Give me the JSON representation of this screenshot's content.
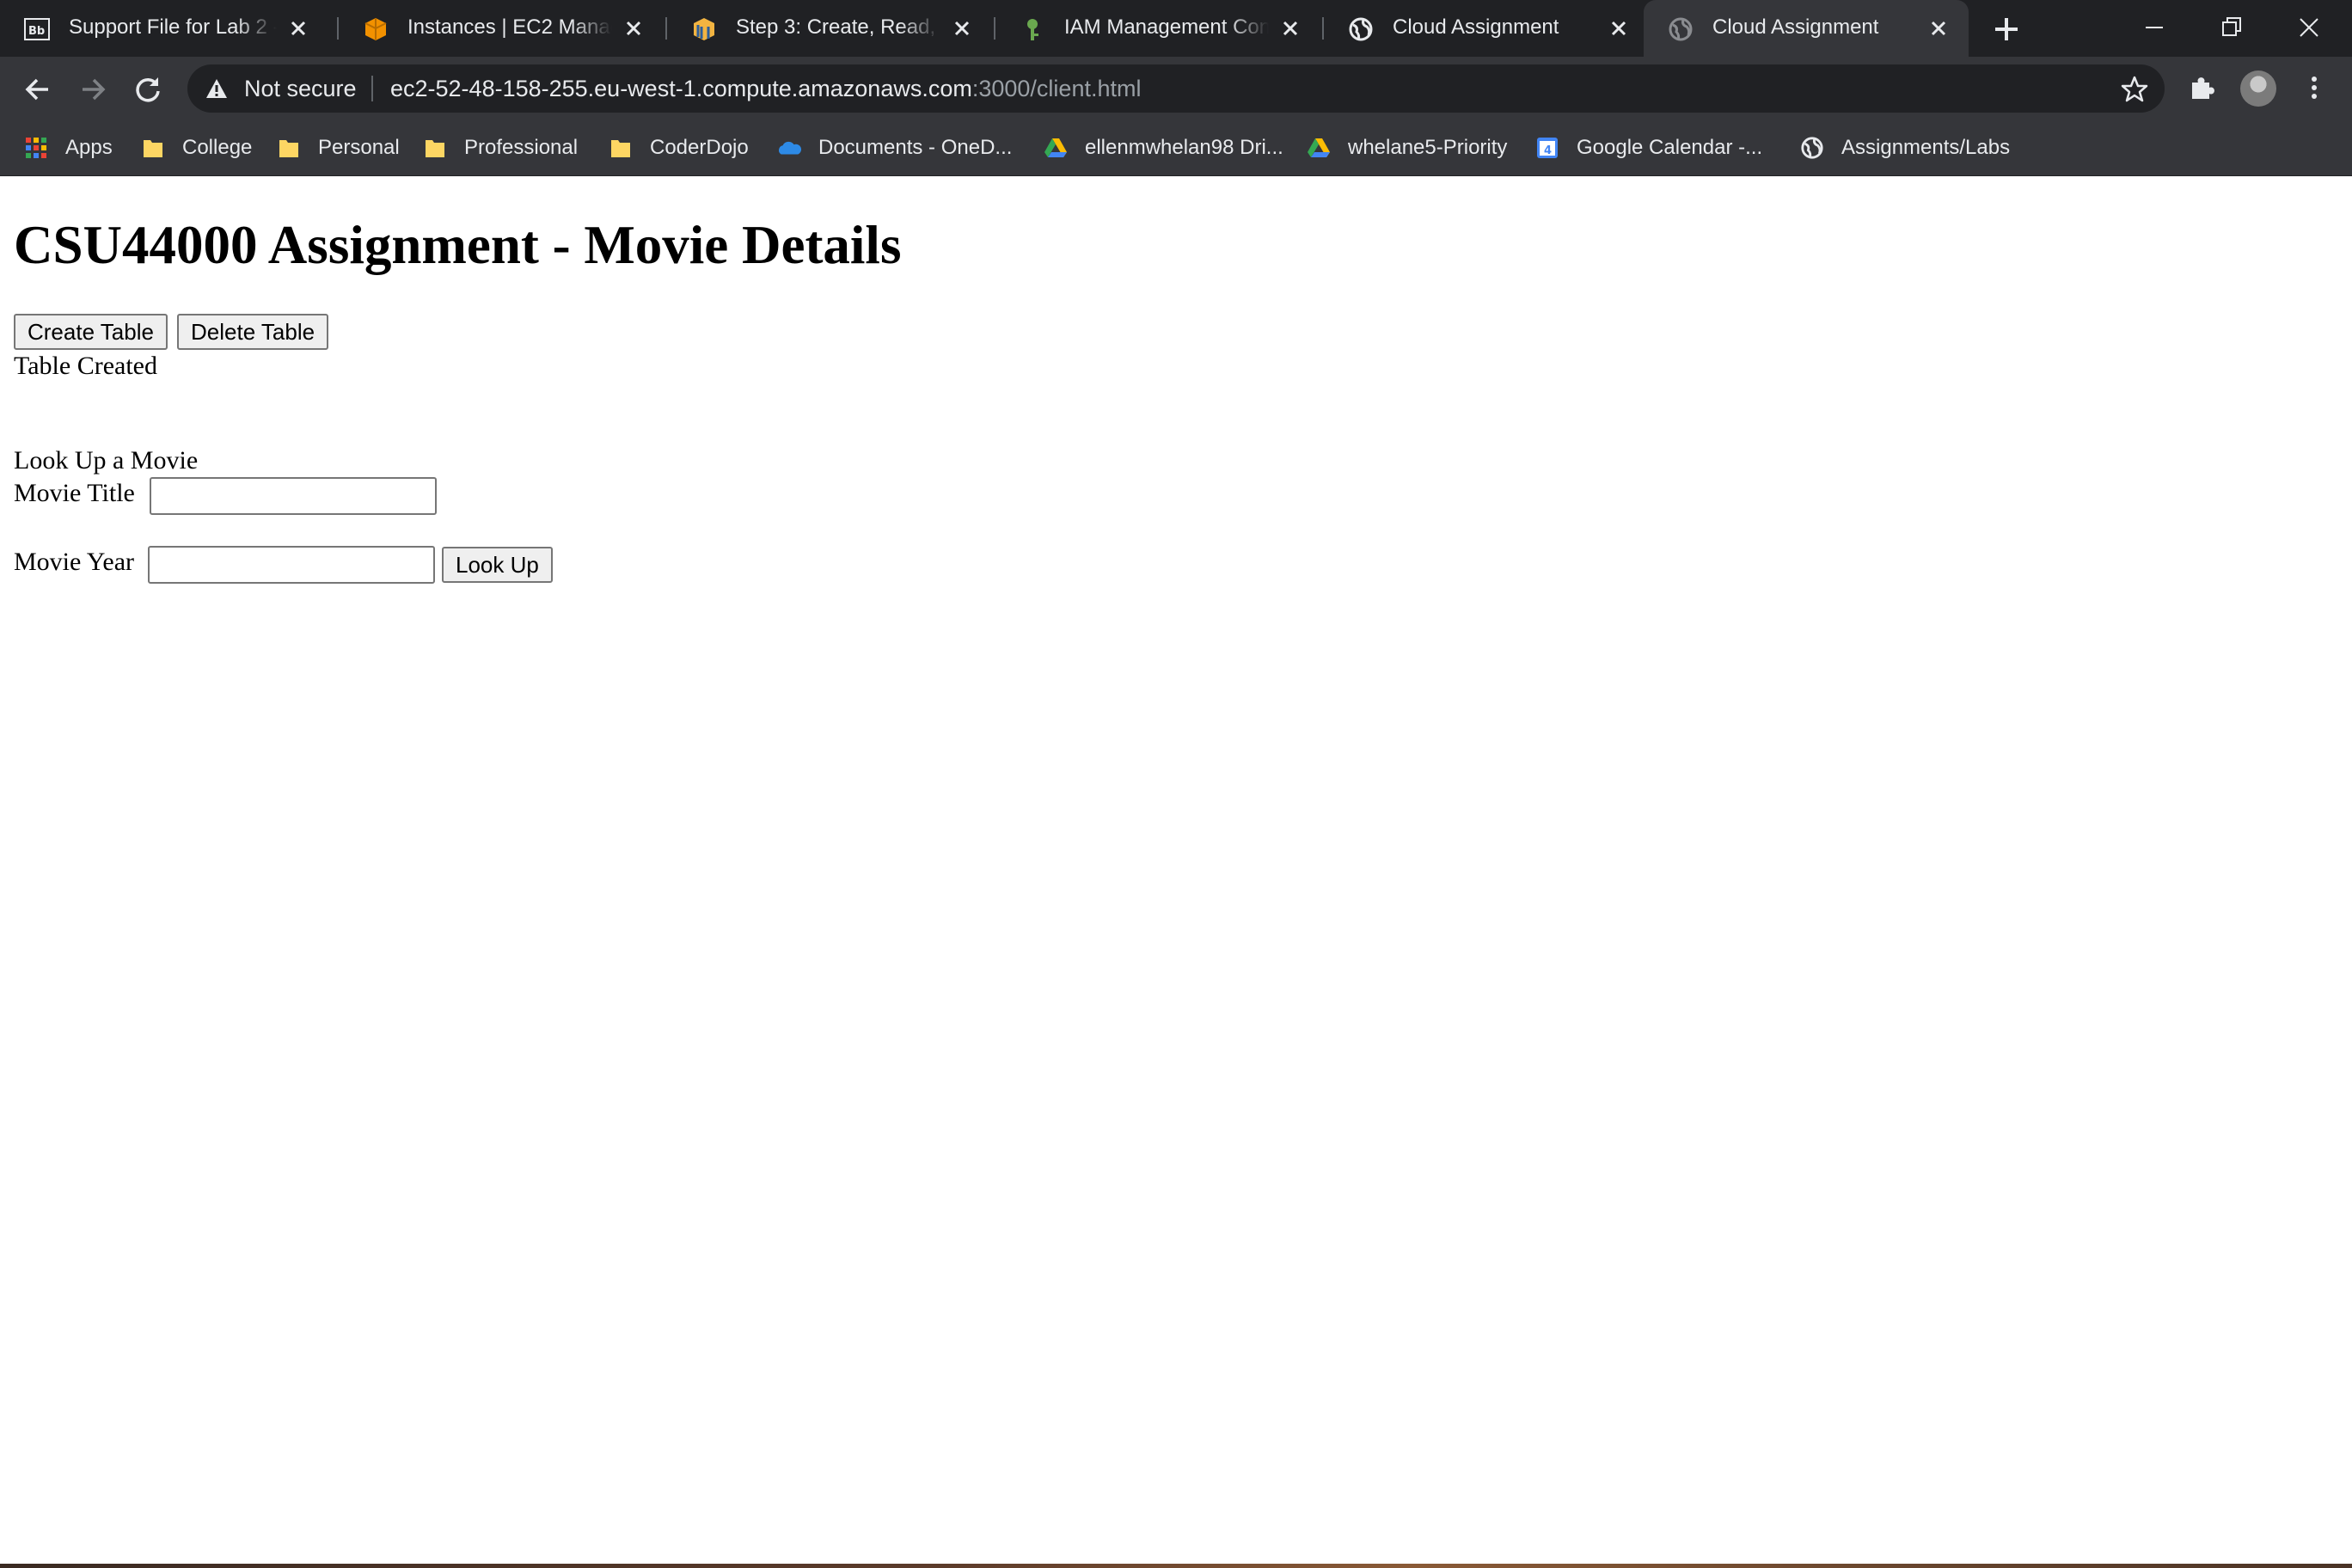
{
  "browser": {
    "tabs": [
      {
        "title": "Support File for Lab 2 -",
        "favicon": "blackboard-icon"
      },
      {
        "title": "Instances | EC2 Manage",
        "favicon": "aws-box-icon"
      },
      {
        "title": "Step 3: Create, Read, Up",
        "favicon": "aws-docs-icon"
      },
      {
        "title": "IAM Management Cons",
        "favicon": "iam-key-icon"
      },
      {
        "title": "Cloud Assignment",
        "favicon": "globe-icon"
      },
      {
        "title": "Cloud Assignment",
        "favicon": "globe-icon",
        "active": true
      }
    ],
    "security_status": "Not secure",
    "url_host": "ec2-52-48-158-255.eu-west-1.compute.amazonaws.com",
    "url_path": ":3000/client.html",
    "bookmarks": [
      {
        "label": "Apps",
        "icon": "apps-grid-icon"
      },
      {
        "label": "College",
        "icon": "folder-icon"
      },
      {
        "label": "Personal",
        "icon": "folder-icon"
      },
      {
        "label": "Professional",
        "icon": "folder-icon"
      },
      {
        "label": "CoderDojo",
        "icon": "folder-icon"
      },
      {
        "label": "Documents - OneD...",
        "icon": "onedrive-icon"
      },
      {
        "label": "ellenmwhelan98 Dri...",
        "icon": "google-drive-icon"
      },
      {
        "label": "whelane5-Priority",
        "icon": "google-drive-icon"
      },
      {
        "label": "Google Calendar -...",
        "icon": "google-calendar-icon",
        "icon_text": "4"
      },
      {
        "label": "Assignments/Labs",
        "icon": "globe-icon"
      }
    ]
  },
  "page": {
    "heading": "CSU44000 Assignment - Movie Details",
    "create_table_label": "Create Table",
    "delete_table_label": "Delete Table",
    "status_message": "Table Created",
    "lookup_heading": "Look Up a Movie",
    "movie_title_label": "Movie Title",
    "movie_title_value": "",
    "movie_year_label": "Movie Year",
    "movie_year_value": "",
    "lookup_button_label": "Look Up"
  },
  "colors": {
    "tab_strip": "#202124",
    "toolbar": "#35363a",
    "text_light": "#e8eaed",
    "url_path": "#9aa0a6"
  }
}
